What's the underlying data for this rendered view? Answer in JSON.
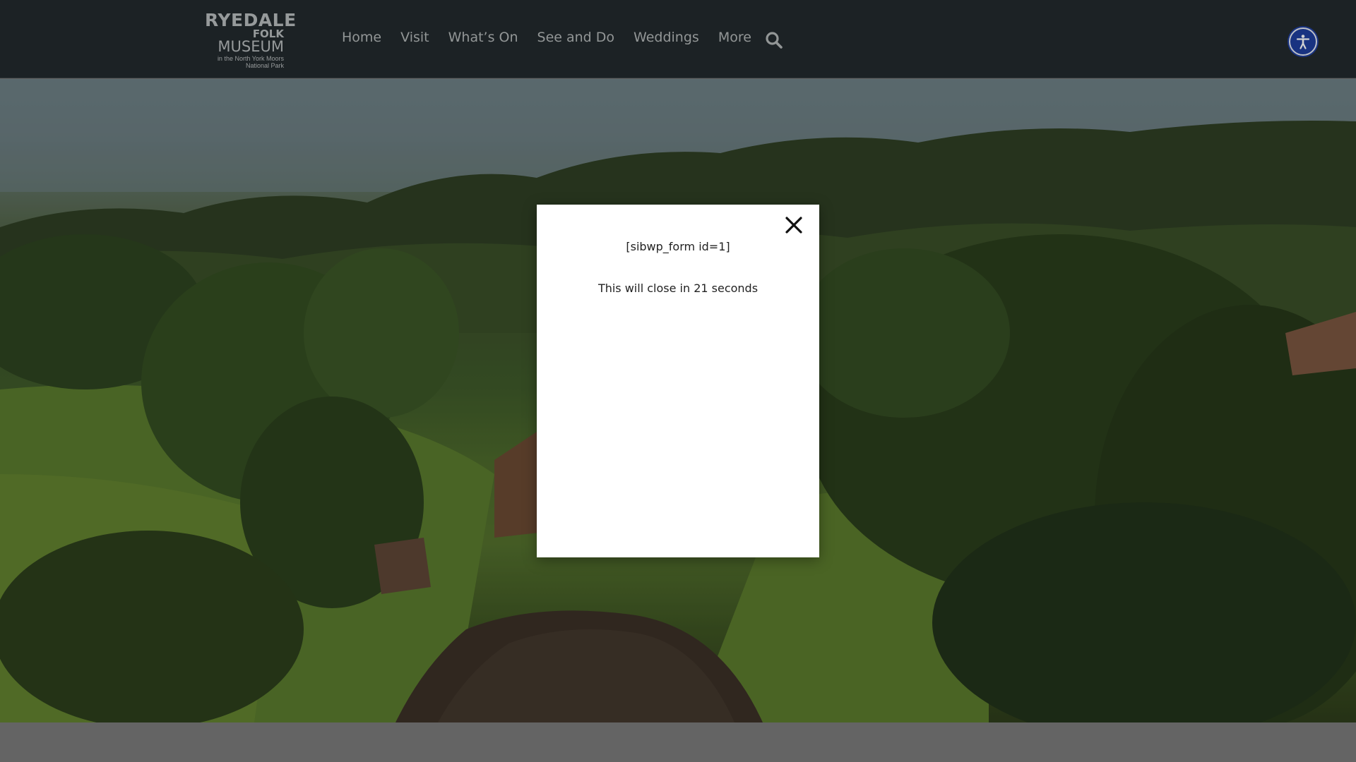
{
  "logo": {
    "line1": "RYEDALE",
    "line2": "FOLK",
    "line3": "MUSEUM",
    "line4": "in the North York Moors",
    "line5": "National Park"
  },
  "nav": {
    "items": [
      {
        "label": "Home"
      },
      {
        "label": "Visit"
      },
      {
        "label": "What’s On"
      },
      {
        "label": "See and Do"
      },
      {
        "label": "Weddings"
      },
      {
        "label": "More"
      }
    ],
    "search_icon": "search-icon"
  },
  "accessibility": {
    "icon": "accessibility-icon",
    "color": "#1f3f9e"
  },
  "modal": {
    "shortcode": "[sibwp_form id=1]",
    "timer_text": "This will close in 21 seconds",
    "close_icon": "close-icon"
  },
  "colors": {
    "header_bg": "#232a2e",
    "nav_text": "#b3b7b8",
    "modal_bg": "#ffffff"
  }
}
